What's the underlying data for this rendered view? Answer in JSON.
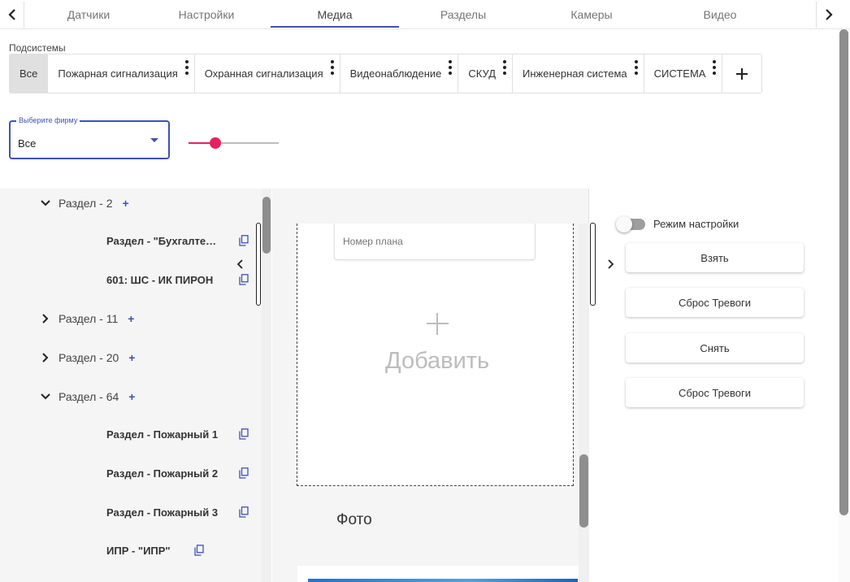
{
  "nav": {
    "tabs": [
      {
        "label": "Датчики"
      },
      {
        "label": "Настройки"
      },
      {
        "label": "Медиа",
        "active": true
      },
      {
        "label": "Разделы"
      },
      {
        "label": "Камеры"
      },
      {
        "label": "Видео"
      }
    ],
    "left_arrow_icon": "chevron-left-icon",
    "right_arrow_icon": "chevron-right-icon"
  },
  "subsystems": {
    "label": "Подсистемы",
    "chips": [
      {
        "label": "Все",
        "selected": true
      },
      {
        "label": "Пожарная сигнализация"
      },
      {
        "label": "Охранная сигнализация"
      },
      {
        "label": "Видеонаблюдение"
      },
      {
        "label": "СКУД"
      },
      {
        "label": "Инженерная система"
      },
      {
        "label": "СИСТЕМА"
      }
    ],
    "add_icon": "plus-icon",
    "menu_icon": "more-vert-icon"
  },
  "firm_select": {
    "label": "Выберите фирму",
    "value": "Все"
  },
  "slider": {
    "value_fraction": 0.3
  },
  "tree": {
    "nodes": [
      {
        "label": "Раздел - 2",
        "expanded": true
      },
      {
        "label": "Раздел - \"Бухгалтерия\"",
        "leaf": true
      },
      {
        "label": "601: ШС - ИК ПИРОН",
        "leaf": true
      },
      {
        "label": "Раздел - 11",
        "expanded": false
      },
      {
        "label": "Раздел - 20",
        "expanded": false
      },
      {
        "label": "Раздел - 64",
        "expanded": true
      },
      {
        "label": "Раздел - Пожарный 1",
        "leaf": true
      },
      {
        "label": "Раздел - Пожарный 2",
        "leaf": true
      },
      {
        "label": "Раздел - Пожарный 3",
        "leaf": true
      },
      {
        "label": "ИПР - \"ИПР\"",
        "leaf": true
      }
    ],
    "add_label": "+"
  },
  "plan": {
    "number_placeholder": "Номер плана",
    "add_label": "Добавить",
    "photo_label": "Фото"
  },
  "controls": {
    "setup_mode_label": "Режим настройки",
    "setup_mode_on": false,
    "buttons": [
      {
        "label": "Взять"
      },
      {
        "label": "Сброс Тревоги"
      },
      {
        "label": "Снять"
      },
      {
        "label": "Сброс Тревоги"
      }
    ]
  },
  "colors": {
    "accent": "#3f51b5",
    "slider": "#e91e63",
    "panel_bg": "#f5f5f5"
  }
}
